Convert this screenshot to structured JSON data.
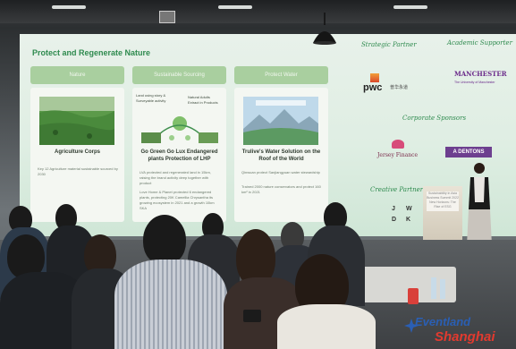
{
  "screen": {
    "title": "Protect and Regenerate Nature",
    "columns": [
      {
        "heading": "Nature",
        "caption": "Agriculture Corps",
        "body": "Key 12 Agriculture material sustainable sourced by 2030"
      },
      {
        "heading": "Sustainable Sourcing",
        "mini_labels": [
          "Land using story & Surveyable activity",
          "Natural Adults Extract in Products"
        ],
        "caption": "Go Green Go Lux Endangered plants Protection of LHP",
        "body": [
          "LVA protected and regenerated land in 15km, raising the brand activity deep together with product",
          "Love Home & Planet protected 6 endangered plants, protecting 20K Camellia Chrysantha its growing ecosystem in 2021 and a growth 10km SKA"
        ]
      },
      {
        "heading": "Protect Water",
        "caption": "Trulive's Water Solution on the Roof of the World",
        "body": [
          "Qinwuan protect Sanjiangyuan water stewardship",
          "Trained 2000 nature conservators and protect 160 km² in 2021"
        ]
      }
    ],
    "partners": {
      "strategic_label": "Strategic Partner",
      "strategic_logo": "pwc",
      "strategic_logo_cn": "普华永道",
      "academic_label": "Academic Supporter",
      "academic_logo": "MANCHESTER",
      "academic_sub": "The University of Manchester",
      "corporate_label": "Corporate Sponsors",
      "sponsor_1": "Jersey Finance",
      "sponsor_2": "A DENTONS",
      "creative_label": "Creative Partner",
      "creative_logo": [
        "J",
        "W",
        "D",
        "K"
      ]
    }
  },
  "podium": {
    "sign": "Sustainability in Asia Business Summit 2022 New Horizons: The Rise of ESG"
  },
  "watermark": {
    "line1": "Eventland",
    "line2": "Shanghai"
  },
  "colors": {
    "screen_green": "#2e8a4e",
    "header_green": "#a9cf9f",
    "brand_blue": "#2a5fb4",
    "brand_red": "#e23a2f"
  }
}
